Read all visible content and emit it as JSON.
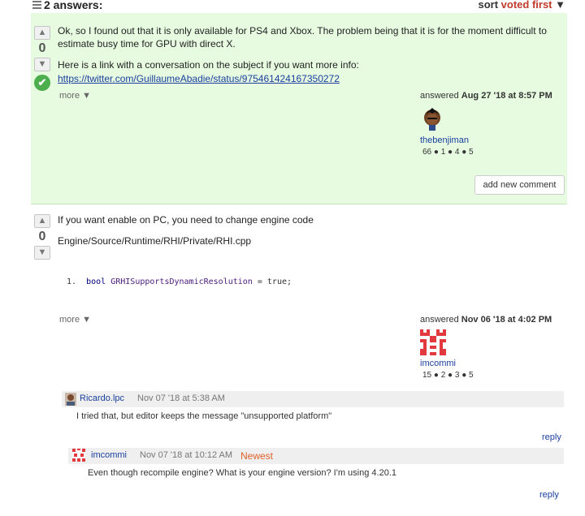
{
  "header": {
    "answers_count": "2 answers:",
    "sort_label": "sort",
    "sort_value": "voted first",
    "sort_arrow": "▼"
  },
  "answers": [
    {
      "vote_up": "▲",
      "vote_count": "0",
      "vote_down": "▼",
      "accepted_icon": "✔",
      "paragraph1": "Ok, so I found out that it is only available for PS4 and Xbox. The problem being that it is for the moment difficult to estimate busy time for GPU with direct X.",
      "paragraph2": "Here is a link with a conversation on the subject if you want more info:",
      "link": "https://twitter.com/GuillaumeAbadie/status/975461424167350272",
      "more": "more ▼",
      "answered_prefix": "answered",
      "answered_date": "Aug 27 '18 at 8:57 PM",
      "user_name": "thebenjiman",
      "user_stats": "66 ● 1 ● 4 ● 5",
      "add_comment": "add new comment"
    },
    {
      "vote_up": "▲",
      "vote_count": "0",
      "vote_down": "▼",
      "paragraph1": "If you want enable on PC, you need to change engine code",
      "paragraph2": "Engine/Source/Runtime/RHI/Private/RHI.cpp",
      "code_line_num": "1.",
      "code_keyword": "bool",
      "code_identifier": "GRHISupportsDynamicResolution",
      "code_rest": "= true;",
      "more": "more ▼",
      "answered_prefix": "answered",
      "answered_date": "Nov 06 '18 at 4:02 PM",
      "user_name": "imcommi",
      "user_stats": "15 ● 2 ● 3 ● 5"
    }
  ],
  "comments": [
    {
      "name": "Ricardo.lpc",
      "date": "Nov 07 '18 at 5:38 AM",
      "text": "I tried that, but editor keeps the message \"unsupported platform\"",
      "reply": "reply"
    },
    {
      "name": "imcommi",
      "date": "Nov 07 '18 at 10:12 AM",
      "badge": "Newest",
      "text": "Even though recompile engine? What is your engine version? I'm using 4.20.1",
      "reply": "reply"
    }
  ],
  "colors": {
    "accepted_bg": "#e6fbe0",
    "link": "#1a3f9e",
    "accent_red": "#c0392b",
    "newest": "#e0602a",
    "accepted_check": "#4cae4c"
  }
}
